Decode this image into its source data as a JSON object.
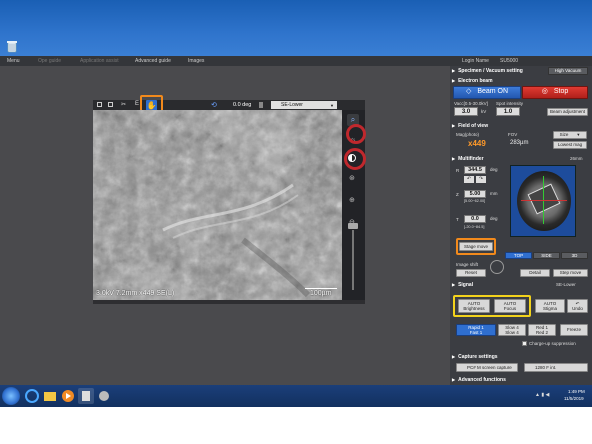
{
  "login": {
    "label": "Login Name",
    "user": "SU5000"
  },
  "menubar": {
    "menu": "Menu",
    "ops_guide": "Ope guide",
    "app_assist": "Application assist",
    "advanced_guide": "Advanced guide",
    "images": "Images"
  },
  "image_toolbar": {
    "rotation": "0.0 deg",
    "detector": "SE-Lower"
  },
  "image_info": {
    "params": "3.0kV 7.2mm x449 SE(L)",
    "scalebar": "100µm"
  },
  "panel": {
    "specimen_vacuum": {
      "title": "Specimen / Vacuum setting",
      "mode": "High Vacuum"
    },
    "electron_beam": {
      "title": "Electron beam",
      "beam_on": "Beam ON",
      "stop": "Stop",
      "vacc_label": "Vacc[0.5-30.0kV]",
      "vacc_value": "3.0",
      "vacc_unit": "kV",
      "spot_label": "Spot intensity",
      "spot_value": "1.0",
      "beam_adjust": "Beam adjustment"
    },
    "field_of_view": {
      "title": "Field of view",
      "mag_label": "Mag(photo)",
      "mag_value": "x449",
      "fov_label": "FOV",
      "fov_value": "283µm",
      "size": "Size",
      "lowest_mag": "Lowest mag"
    },
    "multifinder": {
      "title": "Multifinder",
      "size": "26mm",
      "r_value": "344.5",
      "r_unit": "deg",
      "z_value": "5.00",
      "z_unit": "mm",
      "z_range": "[5.00~62.00]",
      "t_value": "0.0",
      "t_unit": "deg",
      "t_range": "[-20.0~84.5]",
      "stage_move": "Stage move",
      "tab_top": "TOP",
      "tab_side": "SIDE",
      "tab_3d": "3D",
      "image_shift": "Image shift",
      "reset": "Reset",
      "detail": "Detail",
      "step_move": "Step move"
    },
    "signal": {
      "title": "Signal",
      "detector": "SE-Lower",
      "auto_brightness_top": "AUTO",
      "auto_brightness": "Brightness",
      "auto_focus_top": "AUTO",
      "auto_focus": "Focus",
      "auto_stigma_top": "AUTO",
      "auto_stigma": "Stigma",
      "undo": "Undo",
      "rapid1": "Rapid 1",
      "fast1": "Fast 1",
      "slow4": "Slow 4",
      "slow4b": "Slow 4",
      "red1": "Red 1",
      "red2": "Red 2",
      "freeze": "Freeze",
      "charge_up": "Charge-up suppression"
    },
    "capture": {
      "title": "Capture settings",
      "mode": "PC# M screen capture",
      "res": "1280 F int."
    },
    "advanced": {
      "title": "Advanced functions"
    }
  },
  "taskbar": {
    "time": "1:49 PM",
    "date": "11/5/2019"
  }
}
